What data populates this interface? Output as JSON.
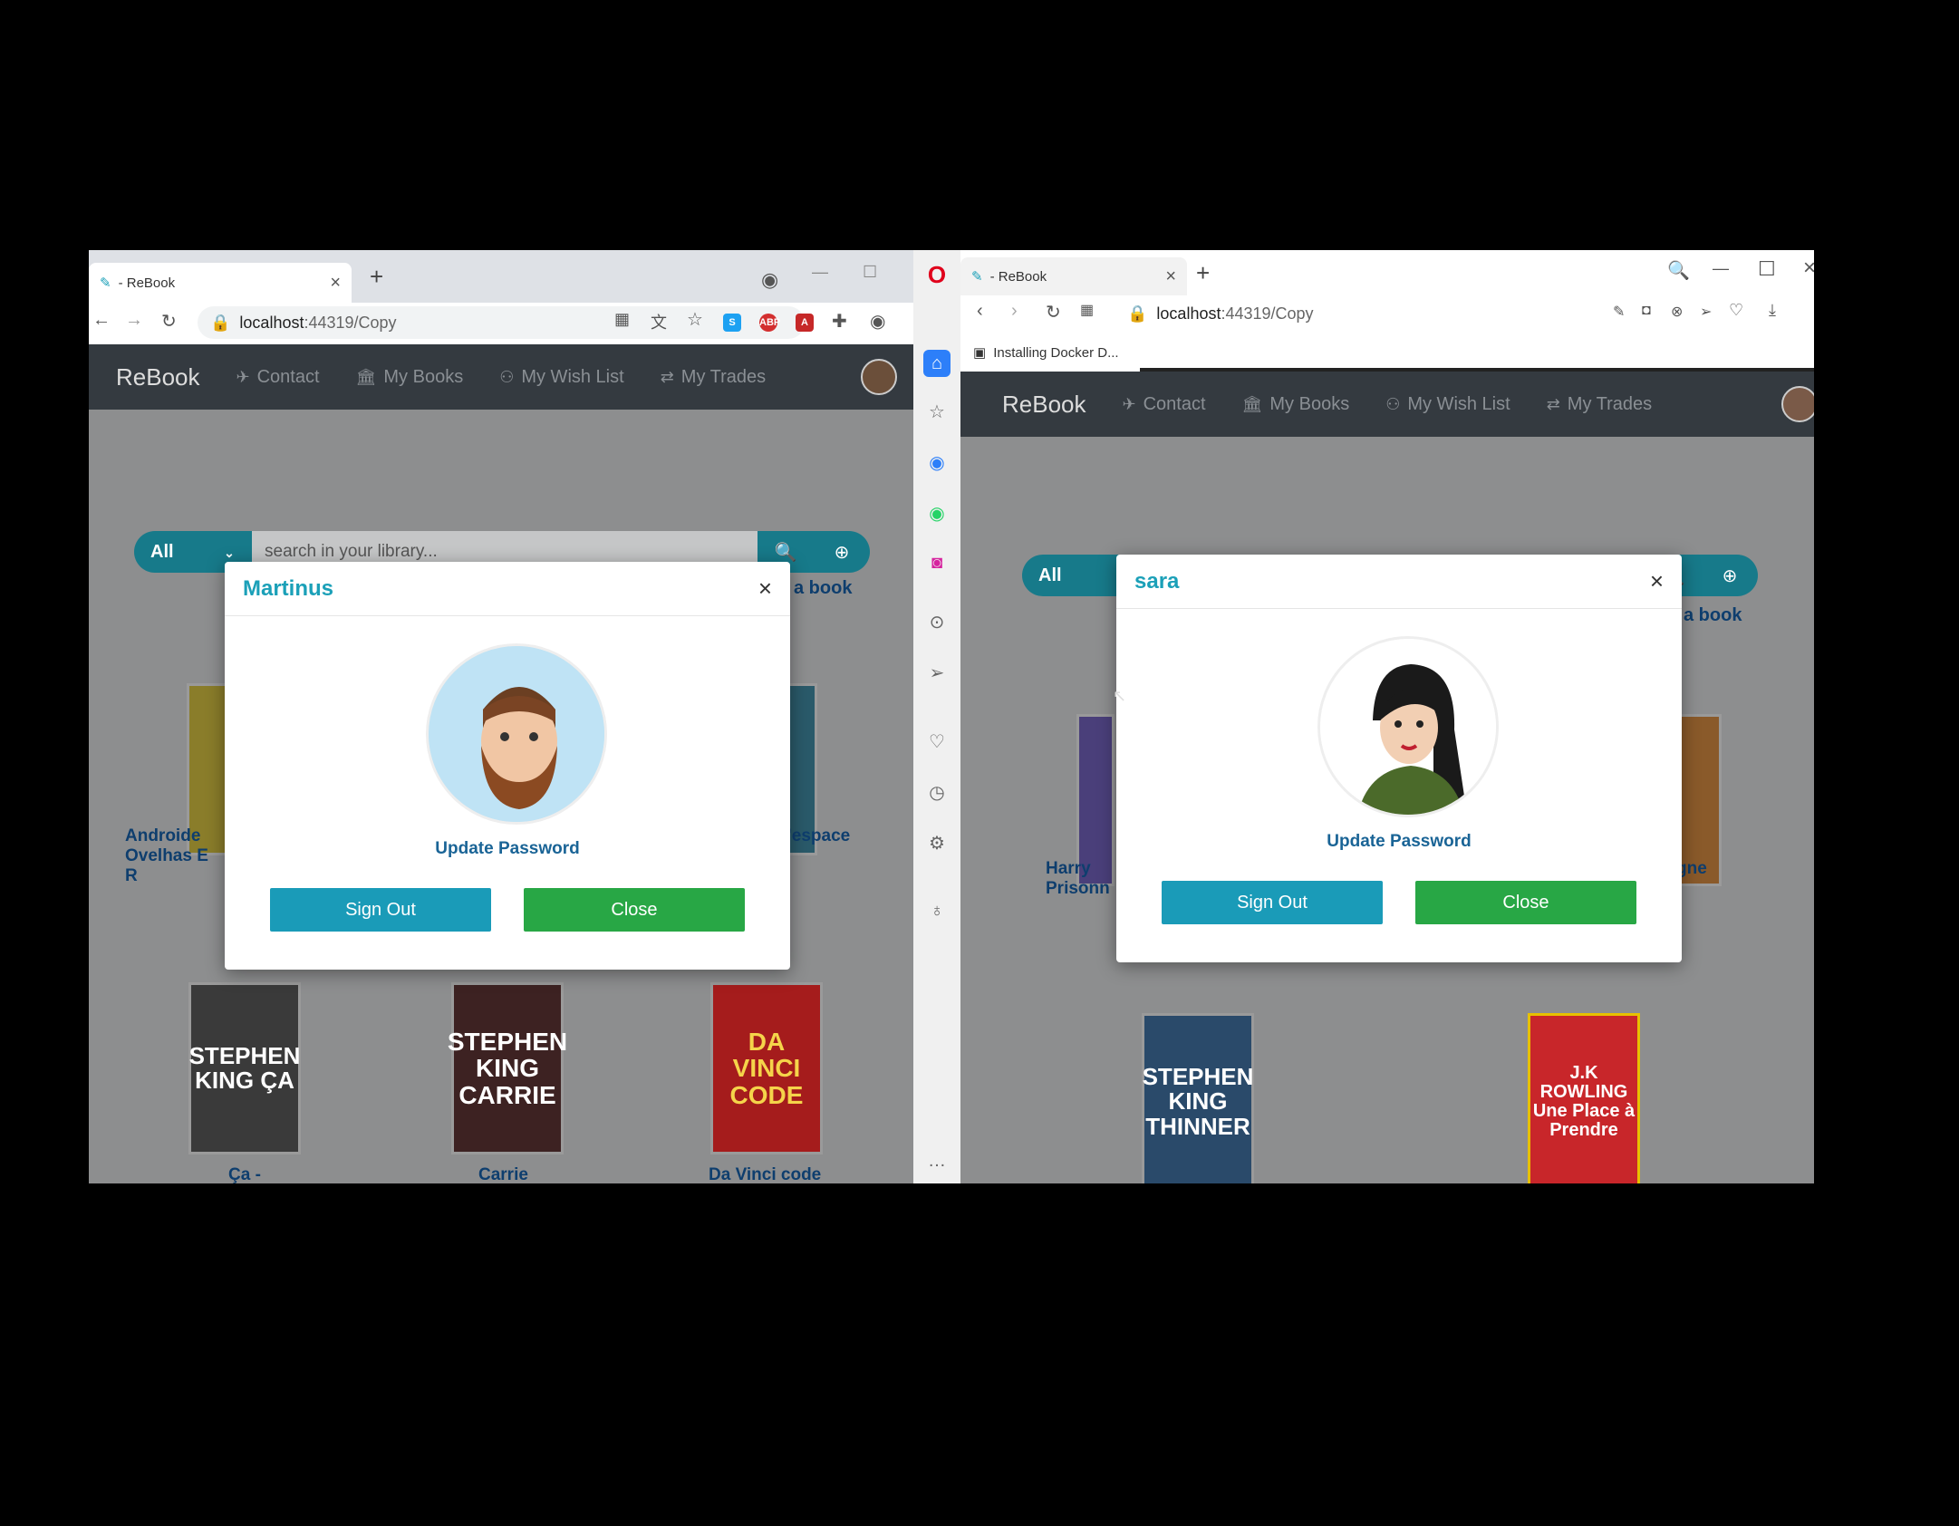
{
  "left_window": {
    "tab_title": "- ReBook",
    "url_host": "localhost",
    "url_path": ":44319/Copy",
    "navbar": {
      "brand": "ReBook",
      "links": [
        "Contact",
        "My Books",
        "My Wish List",
        "My Trades"
      ]
    },
    "search": {
      "category": "All",
      "placeholder": "search in your library..."
    },
    "add_book_link": "a book",
    "books_row1": [
      {
        "label": "Androide\nOvelhas E\nR"
      },
      {
        "label": "l'espace"
      }
    ],
    "books_row2": [
      {
        "cover": "STEPHEN KING ÇA",
        "label": "Ça -"
      },
      {
        "cover": "STEPHEN KING CARRIE",
        "label": "Carrie"
      },
      {
        "cover": "DA VINCI CODE",
        "label": "Da Vinci code"
      }
    ],
    "modal": {
      "title": "Martinus",
      "update_password": "Update Password",
      "sign_out": "Sign Out",
      "close": "Close"
    }
  },
  "right_window": {
    "tab_title": "- ReBook",
    "url_host": "localhost",
    "url_path": ":44319/Copy",
    "bookmark": "Installing Docker D...",
    "navbar": {
      "brand": "ReBook",
      "links": [
        "Contact",
        "My Books",
        "My Wish List",
        "My Trades"
      ]
    },
    "search": {
      "category": "All"
    },
    "add_book_link": "a book",
    "books_row1": [
      {
        "label": "Harry\nPrisonn"
      },
      {
        "label": "gne"
      }
    ],
    "books_row2": [
      {
        "cover": "STEPHEN KING THINNER"
      },
      {
        "cover": "J.K ROWLING Une Place à Prendre"
      }
    ],
    "modal": {
      "title": "sara",
      "update_password": "Update Password",
      "sign_out": "Sign Out",
      "close": "Close"
    }
  }
}
